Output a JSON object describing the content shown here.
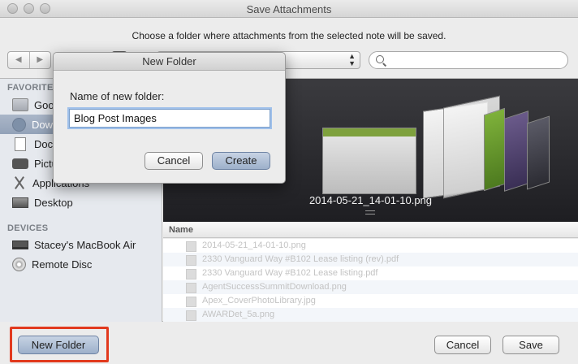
{
  "window": {
    "title": "Save Attachments"
  },
  "prompt": "Choose a folder where attachments from the selected note will be saved.",
  "toolbar": {
    "back_glyph": "◀",
    "forward_glyph": "▶",
    "location": "",
    "search_placeholder": ""
  },
  "sidebar": {
    "favorites_heading": "FAVORITES",
    "favorites": [
      {
        "label": "Google Drive",
        "icon": "folder-icon"
      },
      {
        "label": "Downloads",
        "icon": "downloads-icon"
      },
      {
        "label": "Documents",
        "icon": "document-icon"
      },
      {
        "label": "Pictures",
        "icon": "camera-icon"
      },
      {
        "label": "Applications",
        "icon": "applications-icon"
      },
      {
        "label": "Desktop",
        "icon": "desktop-icon"
      }
    ],
    "devices_heading": "DEVICES",
    "devices": [
      {
        "label": "Stacey's MacBook Air",
        "icon": "laptop-icon"
      },
      {
        "label": "Remote Disc",
        "icon": "disc-icon"
      }
    ]
  },
  "preview": {
    "filename": "2014-05-21_14-01-10.png"
  },
  "file_list": {
    "column_name": "Name",
    "rows": [
      "2014-05-21_14-01-10.png",
      "2330 Vanguard Way #B102 Lease listing (rev).pdf",
      "2330 Vanguard Way #B102 Lease listing.pdf",
      "AgentSuccessSummitDownload.png",
      "Apex_CoverPhotoLibrary.jpg",
      "AWARDet_5a.png"
    ]
  },
  "footer": {
    "new_folder": "New Folder",
    "cancel": "Cancel",
    "save": "Save"
  },
  "dialog": {
    "title": "New Folder",
    "label": "Name of new folder:",
    "value": "Blog Post Images",
    "cancel": "Cancel",
    "create": "Create"
  },
  "colors": {
    "highlight": "#e2391d",
    "default_button": "#9db0ca",
    "sidebar_selection": "#93a2b8"
  }
}
